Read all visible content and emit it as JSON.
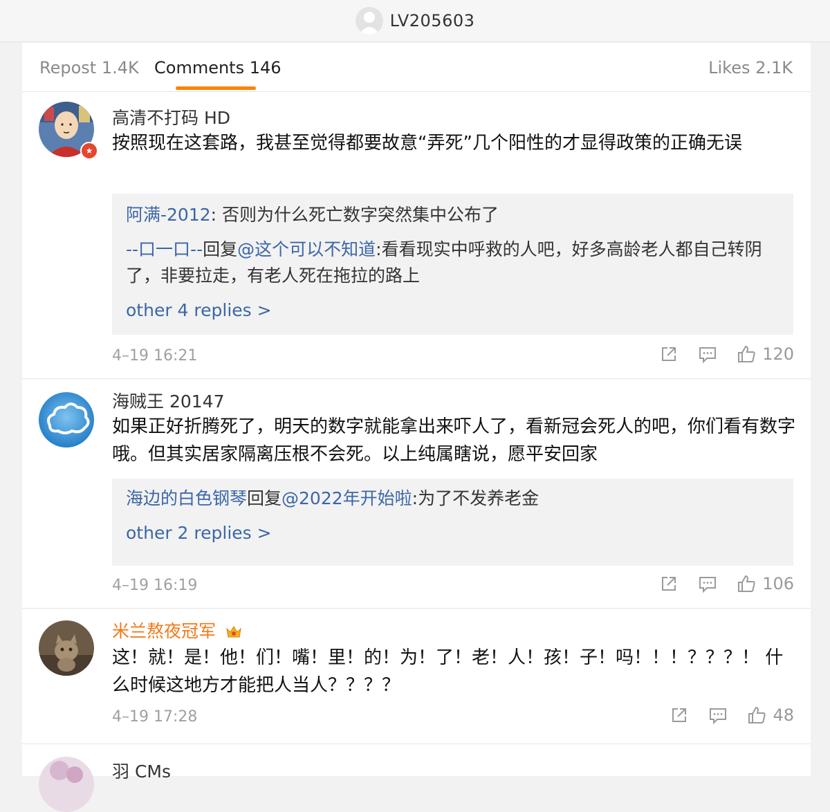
{
  "header": {
    "username": "LV205603"
  },
  "tabs": {
    "repost": "Repost 1.4K",
    "comments": "Comments 146",
    "likes": "Likes 2.1K"
  },
  "comments": [
    {
      "user": "高清不打码 HD",
      "text": "按照现在这套路，我甚至觉得都要故意“弄死”几个阳性的才显得政策的正确无误",
      "replies": [
        {
          "user": "阿满-2012",
          "sep": ": ",
          "text": "否则为什么死亡数字突然集中公布了"
        },
        {
          "user": "--口一口--",
          "reply_word": "回复",
          "mention": "@这个可以不知道",
          "sep": ":",
          "text": "看看现实中呼救的人吧，好多高龄老人都自己转阴了，非要拉走，有老人死在拖拉的路上"
        }
      ],
      "more": "other 4 replies >",
      "time": "4–19 16:21",
      "likes": "120"
    },
    {
      "user": "海贼王 20147",
      "text": "如果正好折腾死了，明天的数字就能拿出来吓人了，看新冠会死人的吧，你们看有数字哦。但其实居家隔离压根不会死。以上纯属瞎说，愿平安回家",
      "replies": [
        {
          "user": "海边的白色钢琴",
          "reply_word": "回复",
          "mention": "@2022年开始啦",
          "sep": ":",
          "text": "为了不发养老金"
        }
      ],
      "more": "other 2 replies >",
      "time": "4–19 16:19",
      "likes": "106"
    },
    {
      "user": "米兰熬夜冠军",
      "text": "这！就！是！他！们！嘴！里！的！为！了！老！人！孩！子！吗！！！？？？！ 什么时候这地方才能把人当人？？？？",
      "time": "4–19 17:28",
      "likes": "48"
    },
    {
      "user": "羽 CMs"
    }
  ],
  "colors": {
    "accent": "#ff8200",
    "link": "#3b66a8",
    "vip_name": "#f07a18"
  },
  "icons": [
    "repost-icon",
    "comment-icon",
    "like-icon",
    "crown-badge-icon",
    "verified-badge-icon"
  ]
}
